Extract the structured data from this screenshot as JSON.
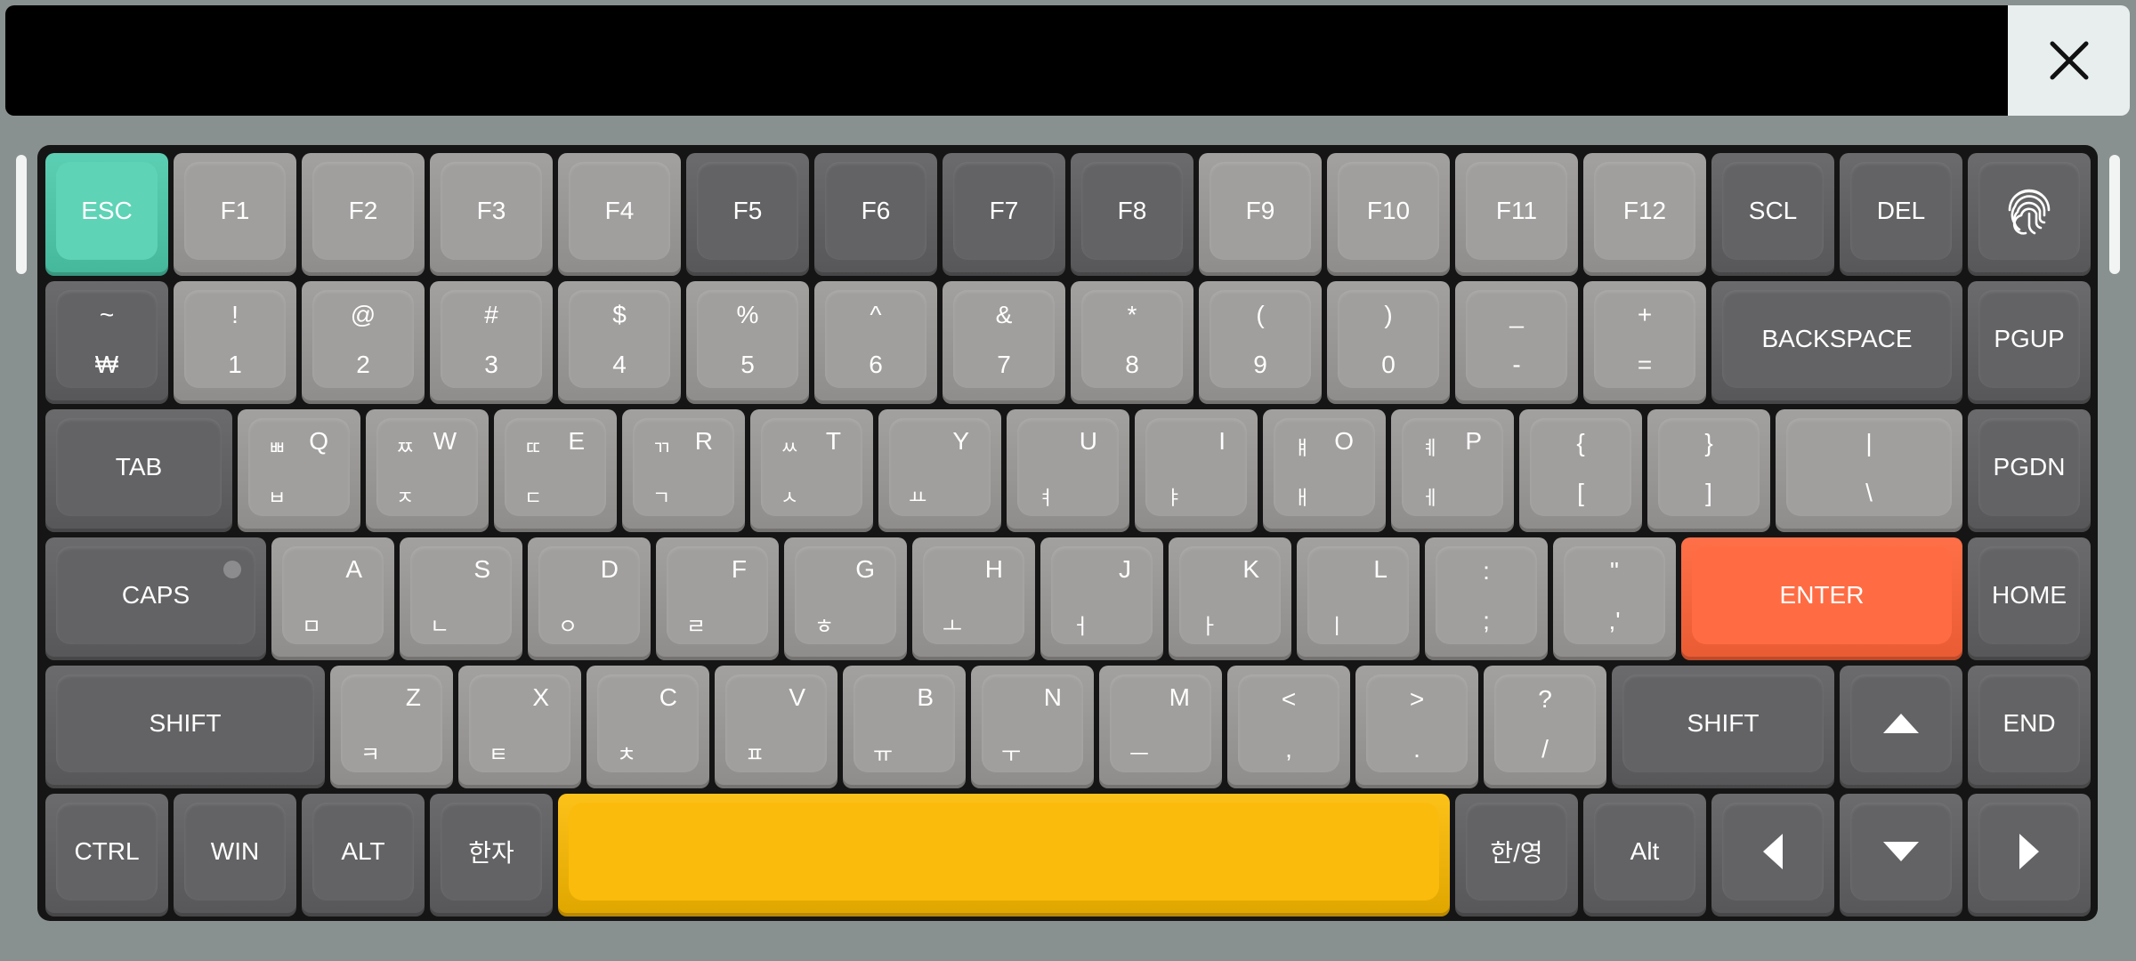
{
  "topbar": {
    "close_icon": "close-icon"
  },
  "colors": {
    "esc": "#5ccfb3",
    "enter": "#ff6c43",
    "space": "#fbbb0c",
    "light_key": "#a19f9d",
    "dark_key": "#636365"
  },
  "row1": [
    "ESC",
    "F1",
    "F2",
    "F3",
    "F4",
    "F5",
    "F6",
    "F7",
    "F8",
    "F9",
    "F10",
    "F11",
    "F12",
    "SCL",
    "DEL"
  ],
  "fingerprint_icon": "fingerprint-icon",
  "row2": [
    {
      "top": "~",
      "bot": "₩"
    },
    {
      "top": "!",
      "bot": "1"
    },
    {
      "top": "@",
      "bot": "2"
    },
    {
      "top": "#",
      "bot": "3"
    },
    {
      "top": "$",
      "bot": "4"
    },
    {
      "top": "%",
      "bot": "5"
    },
    {
      "top": "^",
      "bot": "6"
    },
    {
      "top": "&",
      "bot": "7"
    },
    {
      "top": "*",
      "bot": "8"
    },
    {
      "top": "(",
      "bot": "9"
    },
    {
      "top": ")",
      "bot": "0"
    },
    {
      "top": "_",
      "bot": "-"
    },
    {
      "top": "+",
      "bot": "="
    }
  ],
  "backspace": "BACKSPACE",
  "pgup": "PGUP",
  "tab": "TAB",
  "row3": [
    {
      "en": "Q",
      "krt": "ㅃ",
      "krb": "ㅂ"
    },
    {
      "en": "W",
      "krt": "ㅉ",
      "krb": "ㅈ"
    },
    {
      "en": "E",
      "krt": "ㄸ",
      "krb": "ㄷ"
    },
    {
      "en": "R",
      "krt": "ㄲ",
      "krb": "ㄱ"
    },
    {
      "en": "T",
      "krt": "ㅆ",
      "krb": "ㅅ"
    },
    {
      "en": "Y",
      "krt": "",
      "krb": "ㅛ"
    },
    {
      "en": "U",
      "krt": "",
      "krb": "ㅕ"
    },
    {
      "en": "I",
      "krt": "",
      "krb": "ㅑ"
    },
    {
      "en": "O",
      "krt": "ㅒ",
      "krb": "ㅐ"
    },
    {
      "en": "P",
      "krt": "ㅖ",
      "krb": "ㅔ"
    }
  ],
  "brackets": [
    {
      "top": "{",
      "bot": "["
    },
    {
      "top": "}",
      "bot": "]"
    },
    {
      "top": "|",
      "bot": "\\"
    }
  ],
  "pgdn": "PGDN",
  "caps": "CAPS",
  "row4": [
    {
      "en": "A",
      "kr": "ㅁ"
    },
    {
      "en": "S",
      "kr": "ㄴ"
    },
    {
      "en": "D",
      "kr": "ㅇ"
    },
    {
      "en": "F",
      "kr": "ㄹ"
    },
    {
      "en": "G",
      "kr": "ㅎ"
    },
    {
      "en": "H",
      "kr": "ㅗ"
    },
    {
      "en": "J",
      "kr": "ㅓ"
    },
    {
      "en": "K",
      "kr": "ㅏ"
    },
    {
      "en": "L",
      "kr": "ㅣ"
    }
  ],
  "punct4": [
    {
      "top": ":",
      "bot": ";"
    },
    {
      "top": "\"",
      "bot": ",'"
    }
  ],
  "enter": "ENTER",
  "home": "HOME",
  "shift": "SHIFT",
  "row5": [
    {
      "en": "Z",
      "kr": "ㅋ"
    },
    {
      "en": "X",
      "kr": "ㅌ"
    },
    {
      "en": "C",
      "kr": "ㅊ"
    },
    {
      "en": "V",
      "kr": "ㅍ"
    },
    {
      "en": "B",
      "kr": "ㅠ"
    },
    {
      "en": "N",
      "kr": "ㅜ"
    },
    {
      "en": "M",
      "kr": "ㅡ"
    }
  ],
  "punct5": [
    {
      "top": "<",
      "bot": ","
    },
    {
      "top": ">",
      "bot": "."
    },
    {
      "top": "?",
      "bot": "/"
    }
  ],
  "end": "END",
  "row6": {
    "ctrl": "CTRL",
    "win": "WIN",
    "alt": "ALT",
    "hanja": "한자",
    "hanyeong": "한/영",
    "alt2": "Alt"
  }
}
